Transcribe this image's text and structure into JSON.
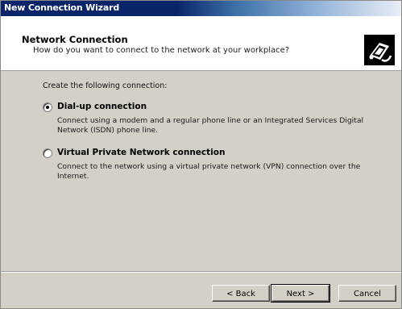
{
  "window": {
    "title": "New Connection Wizard"
  },
  "header": {
    "title": "Network Connection",
    "subtitle": "How do you want to connect to the network at your workplace?",
    "icon": "network-connection-icon"
  },
  "content": {
    "prompt": "Create the following connection:",
    "options": [
      {
        "label": "Dial-up connection",
        "description": "Connect using a modem and a regular phone line or an Integrated Services Digital Network (ISDN) phone line.",
        "selected": true
      },
      {
        "label": "Virtual Private Network connection",
        "description": "Connect to the network using a virtual private network (VPN) connection over the Internet.",
        "selected": false
      }
    ]
  },
  "buttons": {
    "back": "< Back",
    "next": "Next >",
    "cancel": "Cancel"
  },
  "colors": {
    "title_bar": "#0a246a",
    "dialog_face": "#d4d0c8",
    "header_bg": "#ffffff"
  }
}
